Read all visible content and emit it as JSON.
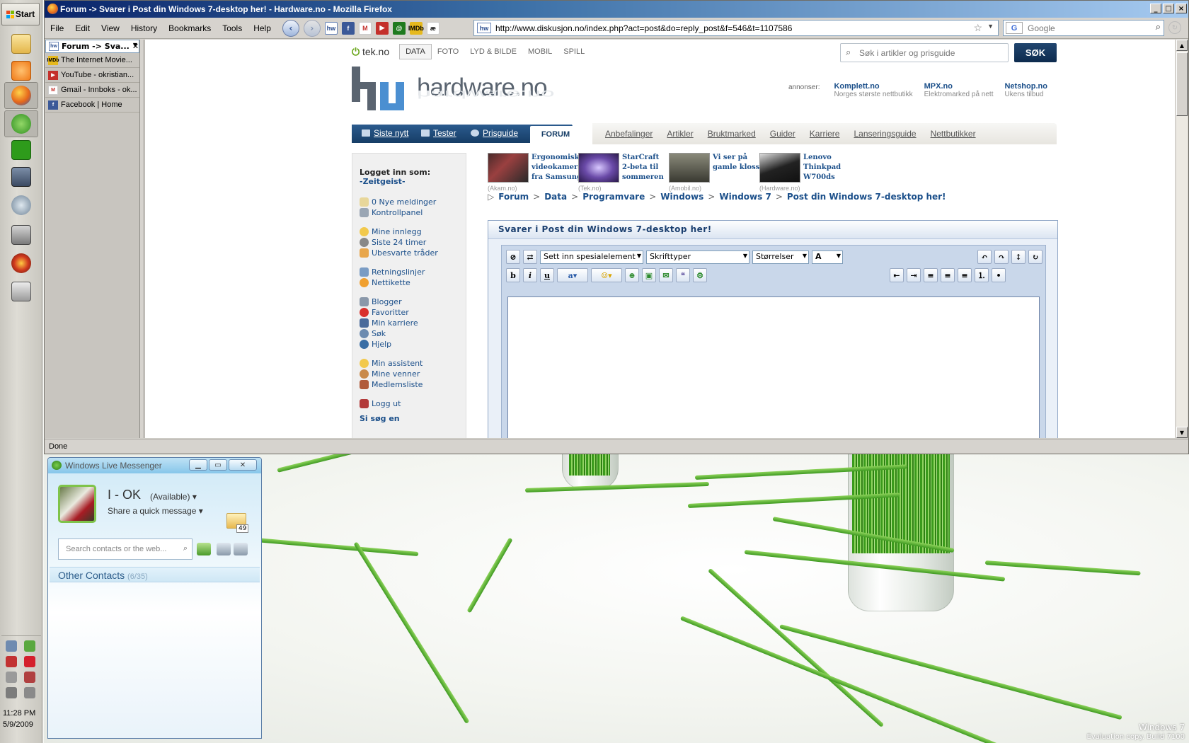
{
  "taskbar": {
    "start_label": "Start",
    "clock_time": "11:28 PM",
    "clock_date": "5/9/2009"
  },
  "firefox": {
    "title": "Forum -> Svarer i Post din Windows 7-desktop her! - Hardware.no - Mozilla Firefox",
    "menu": [
      "File",
      "Edit",
      "View",
      "History",
      "Bookmarks",
      "Tools",
      "Help"
    ],
    "url": "http://www.diskusjon.no/index.php?act=post&do=reply_post&f=546&t=1107586",
    "search_placeholder": "Google",
    "status": "Done",
    "tabs": [
      {
        "label": "Forum -> Sva...",
        "icon": "hw"
      },
      {
        "label": "The Internet Movie...",
        "icon": "imdb"
      },
      {
        "label": "YouTube - okristian...",
        "icon": "youtube"
      },
      {
        "label": "Gmail - Innboks - ok...",
        "icon": "gmail"
      },
      {
        "label": "Facebook | Home",
        "icon": "facebook"
      }
    ]
  },
  "site": {
    "tek_logo": "tek.no",
    "categories": [
      "DATA",
      "FOTO",
      "LYD & BILDE",
      "MOBIL",
      "SPILL"
    ],
    "search_placeholder": "Søk i artikler og prisguide",
    "search_button": "SØK",
    "logo_text": "hardware.no",
    "ads_label": "annonser:",
    "ads": [
      {
        "name": "Komplett.no",
        "desc": "Norges største nettbutikk"
      },
      {
        "name": "MPX.no",
        "desc": "Elektromarked på nett"
      },
      {
        "name": "Netshop.no",
        "desc": "Ukens tilbud"
      }
    ],
    "nav_tabs": [
      "Siste nytt",
      "Tester",
      "Prisguide"
    ],
    "forum_tab": "FORUM",
    "nav_links": [
      "Anbefalinger",
      "Artikler",
      "Bruktmarked",
      "Guider",
      "Karriere",
      "Lanseringsguide",
      "Nettbutikker"
    ],
    "logged_in_label": "Logget inn som:",
    "username": "-Zeitgeist-",
    "user_links": [
      "0 Nye meldinger",
      "Kontrollpanel",
      "Mine innlegg",
      "Siste 24 timer",
      "Ubesvarte tråder",
      "Retningslinjer",
      "Nettikette",
      "Blogger",
      "Favoritter",
      "Min karriere",
      "Søk",
      "Hjelp",
      "Min assistent",
      "Mine venner",
      "Medlemsliste",
      "Logg ut",
      "Si søg en"
    ],
    "news": [
      {
        "title1": "Ergonomisk",
        "title2": "videokamera",
        "title3": "fra Samsung",
        "source": "(Akam.no)"
      },
      {
        "title1": "StarCraft",
        "title2": "2-beta til",
        "title3": "sommeren",
        "source": "(Tek.no)"
      },
      {
        "title1": "Vi ser på",
        "title2": "gamle klosser",
        "title3": "",
        "source": "(Amobil.no)"
      },
      {
        "title1": "Lenovo",
        "title2": "Thinkpad",
        "title3": "W700ds",
        "source": "(Hardware.no)"
      }
    ],
    "breadcrumb": [
      "Forum",
      "Data",
      "Programvare",
      "Windows",
      "Windows 7",
      "Post din Windows 7-desktop her!"
    ],
    "editor_title": "Svarer i Post din Windows 7-desktop her!",
    "special_select": "Sett inn spesialelement",
    "font_select": "Skrifttyper",
    "size_select": "Størrelser",
    "format_bold": "b",
    "format_italic": "i",
    "format_underline": "u"
  },
  "messenger": {
    "title": "Windows Live Messenger",
    "name": "I - OK",
    "status": "(Available)",
    "share_msg": "Share a quick message",
    "mail_count": "49",
    "search_placeholder": "Search contacts or the web...",
    "group_label": "Other Contacts",
    "group_count": "(6/35)"
  },
  "desktop": {
    "watermark_title": "Windows 7",
    "watermark_build": "Evaluation copy. Build 7100"
  }
}
